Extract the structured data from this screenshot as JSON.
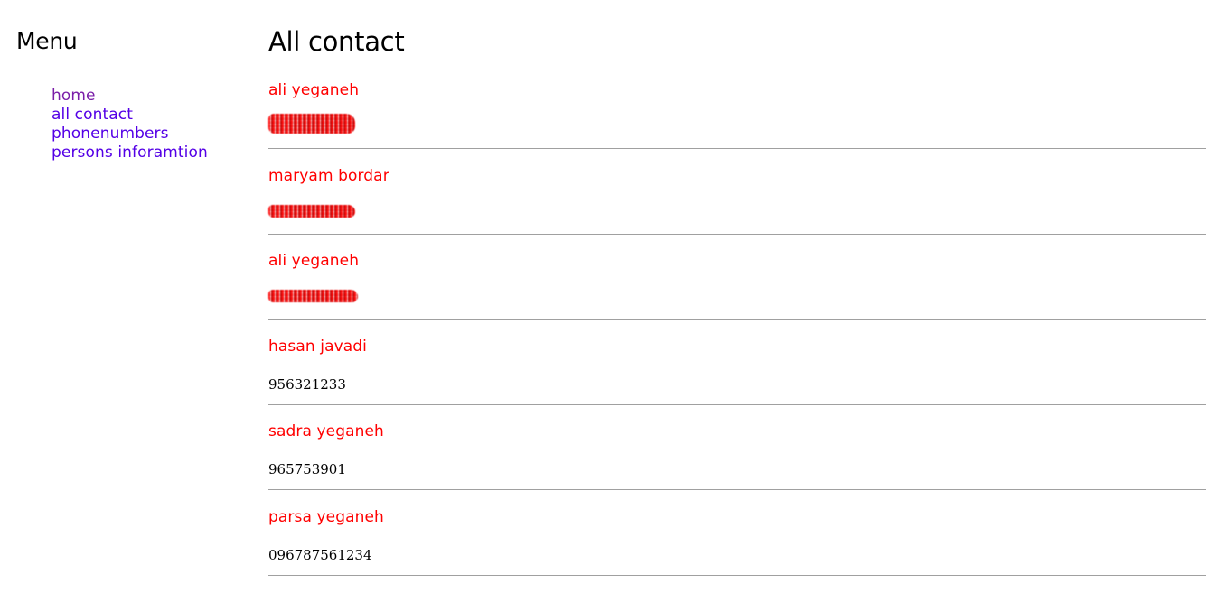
{
  "sidebar": {
    "title": "Menu",
    "items": [
      {
        "label": "home"
      },
      {
        "label": "all contact"
      },
      {
        "label": "phonenumbers"
      },
      {
        "label": "persons inforamtion"
      }
    ]
  },
  "main": {
    "title": "All contact",
    "contacts": [
      {
        "name": "ali yeganeh",
        "phone": ""
      },
      {
        "name": "maryam bordar",
        "phone": ""
      },
      {
        "name": "ali yeganeh",
        "phone": ""
      },
      {
        "name": "hasan javadi",
        "phone": "956321233"
      },
      {
        "name": "sadra yeganeh",
        "phone": "965753901"
      },
      {
        "name": "parsa yeganeh",
        "phone": "096787561234"
      }
    ]
  },
  "colors": {
    "contact_name": "#ff0000",
    "link_visited": "#7a1ea8",
    "link_unvisited": "#5400e6",
    "divider": "#a0a0a0"
  }
}
